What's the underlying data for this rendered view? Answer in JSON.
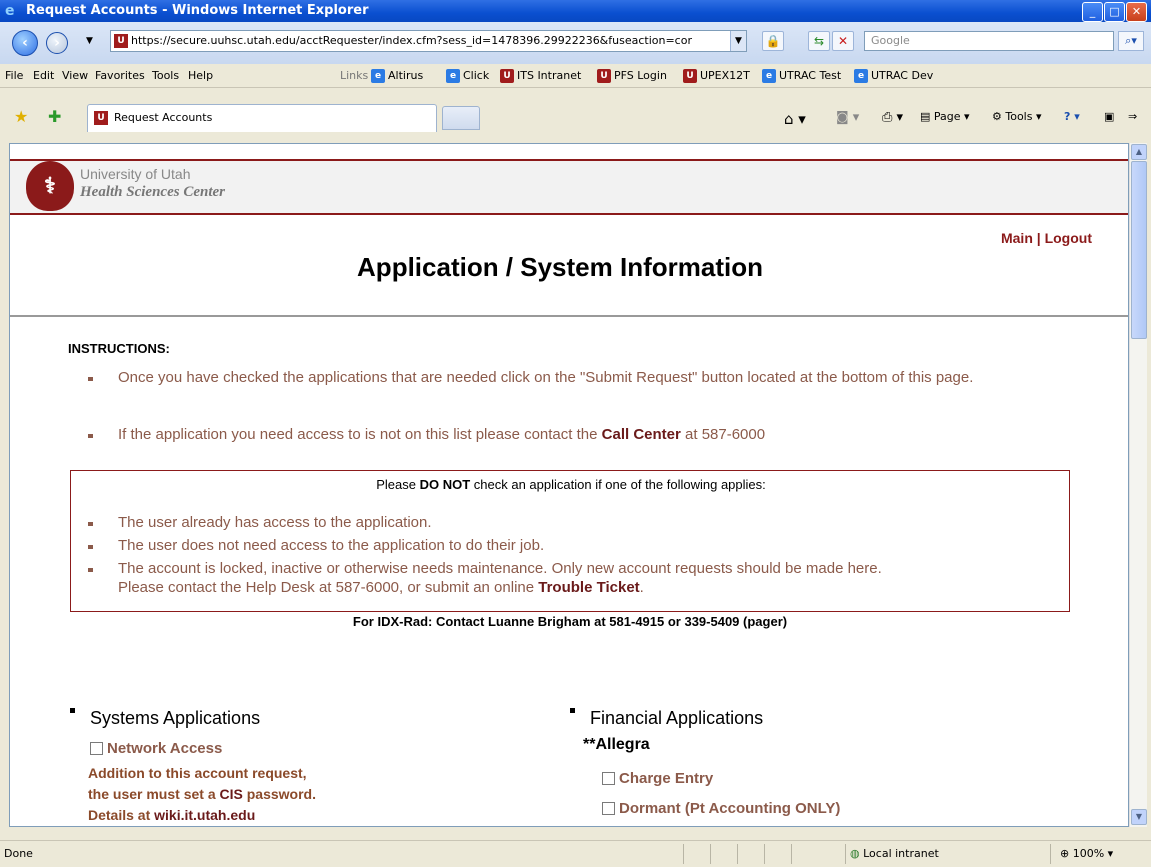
{
  "window": {
    "title": "Request Accounts - Windows Internet Explorer"
  },
  "address": {
    "url": "https://secure.uuhsc.utah.edu/acctRequester/index.cfm?sess_id=1478396.29922236&fuseaction=cor",
    "search_placeholder": "Google"
  },
  "menu": [
    "File",
    "Edit",
    "View",
    "Favorites",
    "Tools",
    "Help"
  ],
  "links": {
    "label": "Links",
    "items": [
      "Altirus",
      "Click",
      "ITS Intranet",
      "PFS Login",
      "UPEX12T",
      "UTRAC Test",
      "UTRAC Dev"
    ]
  },
  "tab": {
    "label": "Request Accounts"
  },
  "commands": {
    "page": "Page",
    "tools": "Tools"
  },
  "page": {
    "org_line1": "University of Utah",
    "org_line2": "Health Sciences Center",
    "link_main": "Main",
    "link_sep": "|",
    "link_logout": "Logout",
    "title": "Application / System Information",
    "instructions_label": "INSTRUCTIONS:",
    "instr1": "Once you have checked the applications that are needed click on the \"Submit Request\" button located at the bottom of this page.",
    "instr2_pre": "If the application you need access to is not on this list please contact the ",
    "instr2_link": "Call Center",
    "instr2_post": " at 587-6000",
    "warn_pre": "Please ",
    "warn_bold": "DO NOT",
    "warn_post": " check an application if one of the following applies:",
    "warn1": "The user already has access to the application.",
    "warn2": "The user does not need access to the application to do their job.",
    "warn3a": "The account is locked, inactive or otherwise needs maintenance. Only new account requests should be made here.",
    "warn3b_pre": "Please contact the Help Desk at 587-6000, or submit an online ",
    "warn3b_link": "Trouble Ticket",
    "warn3b_post": ".",
    "idx_note": "For IDX-Rad: Contact Luanne Brigham at 581-4915 or 339-5409 (pager)",
    "systems": {
      "heading": "Systems Applications",
      "network": "Network Access",
      "note1": "Addition to this account request,",
      "note2_pre": "the user must set a ",
      "note2_link": "CIS",
      "note2_post": " password.",
      "note3_pre": "Details at ",
      "note3_link": "wiki.it.utah.edu"
    },
    "financial": {
      "heading": "Financial Applications",
      "group": "**Allegra",
      "item1": "Charge Entry",
      "item2": "Dormant (Pt Accounting ONLY)"
    }
  },
  "status": {
    "left": "Done",
    "zone": "Local intranet",
    "zoom": "100%"
  }
}
